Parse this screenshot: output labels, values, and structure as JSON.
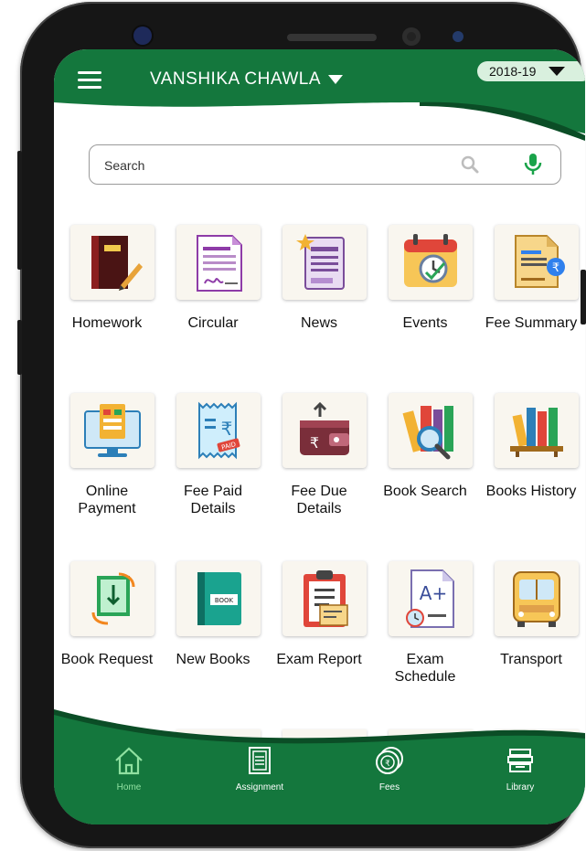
{
  "header": {
    "user_name": "VANSHIKA  CHAWLA",
    "academic_year": "2018-19"
  },
  "search": {
    "placeholder": "Search"
  },
  "tiles": [
    {
      "label": "Homework",
      "icon": "homework-book-icon"
    },
    {
      "label": "Circular",
      "icon": "circular-document-icon"
    },
    {
      "label": "News",
      "icon": "newspaper-icon"
    },
    {
      "label": "Events",
      "icon": "calendar-clock-icon"
    },
    {
      "label": "Fee Summary",
      "icon": "fee-summary-icon"
    },
    {
      "label": "Online\nPayment",
      "icon": "online-payment-icon"
    },
    {
      "label": "Fee Paid\nDetails",
      "icon": "fee-paid-receipt-icon"
    },
    {
      "label": "Fee Due\nDetails",
      "icon": "wallet-icon"
    },
    {
      "label": "Book Search",
      "icon": "book-search-icon"
    },
    {
      "label": "Books History",
      "icon": "books-shelf-icon"
    },
    {
      "label": "Book Request",
      "icon": "book-request-icon"
    },
    {
      "label": "New Books",
      "icon": "new-book-icon"
    },
    {
      "label": "Exam Report",
      "icon": "exam-report-clipboard-icon"
    },
    {
      "label": "Exam\nSchedule",
      "icon": "exam-schedule-icon"
    },
    {
      "label": "Transport",
      "icon": "bus-icon"
    }
  ],
  "new_book_text": "BOOK",
  "paid_stamp": "PAID",
  "grade_text": "A+",
  "bottom_nav": [
    {
      "label": "Home",
      "icon": "home-icon",
      "active": true
    },
    {
      "label": "Assignment",
      "icon": "assignment-icon",
      "active": false
    },
    {
      "label": "Fees",
      "icon": "fees-coins-icon",
      "active": false
    },
    {
      "label": "Library",
      "icon": "library-books-icon",
      "active": false
    }
  ],
  "colors": {
    "primary_green": "#14773d",
    "dark_green": "#0e5f2f",
    "active_nav": "#8fe0a0",
    "pill_bg": "#d9f0de"
  }
}
